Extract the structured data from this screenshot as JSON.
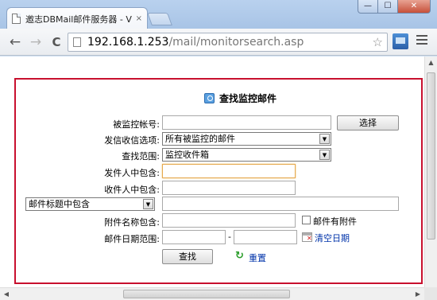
{
  "browser": {
    "tab_title": "邀志DBMail邮件服务器 - V",
    "tab_close": "×",
    "url_host": "192.168.1.253",
    "url_path": "/mail/monitorsearch.asp",
    "window_controls": {
      "minimize": "—",
      "maximize": "☐",
      "close": "✕"
    },
    "nav": {
      "back": "←",
      "forward": "→",
      "reload": "C"
    },
    "star": "☆"
  },
  "form": {
    "title": "查找监控邮件",
    "monitored_account": {
      "label": "被监控帐号:",
      "value": ""
    },
    "select_button": "选择",
    "send_receive": {
      "label": "发信收信选项:",
      "value": "所有被监控的邮件"
    },
    "search_scope": {
      "label": "查找范围:",
      "value": "监控收件箱"
    },
    "sender_contains": {
      "label": "发件人中包含:",
      "value": ""
    },
    "recipient_contains": {
      "label": "收件人中包含:",
      "value": ""
    },
    "subject_select": {
      "value": "邮件标题中包含"
    },
    "subject_input": {
      "value": ""
    },
    "attachment_name": {
      "label": "附件名称包含:",
      "value": ""
    },
    "has_attachment": {
      "label": "邮件有附件",
      "checked": false
    },
    "date_range": {
      "label": "邮件日期范围:",
      "separator": "-",
      "from": "",
      "to": ""
    },
    "clear_date": "清空日期",
    "search_button": "查找",
    "reset_link": "重置"
  },
  "icons": {
    "tab": "page-icon",
    "title": "search-icon",
    "clear_date": "calendar-clear-icon",
    "reset": "refresh-icon"
  },
  "colors": {
    "panel_border": "#c8102e",
    "link": "#0033aa",
    "focus_border": "#e6a94f"
  }
}
